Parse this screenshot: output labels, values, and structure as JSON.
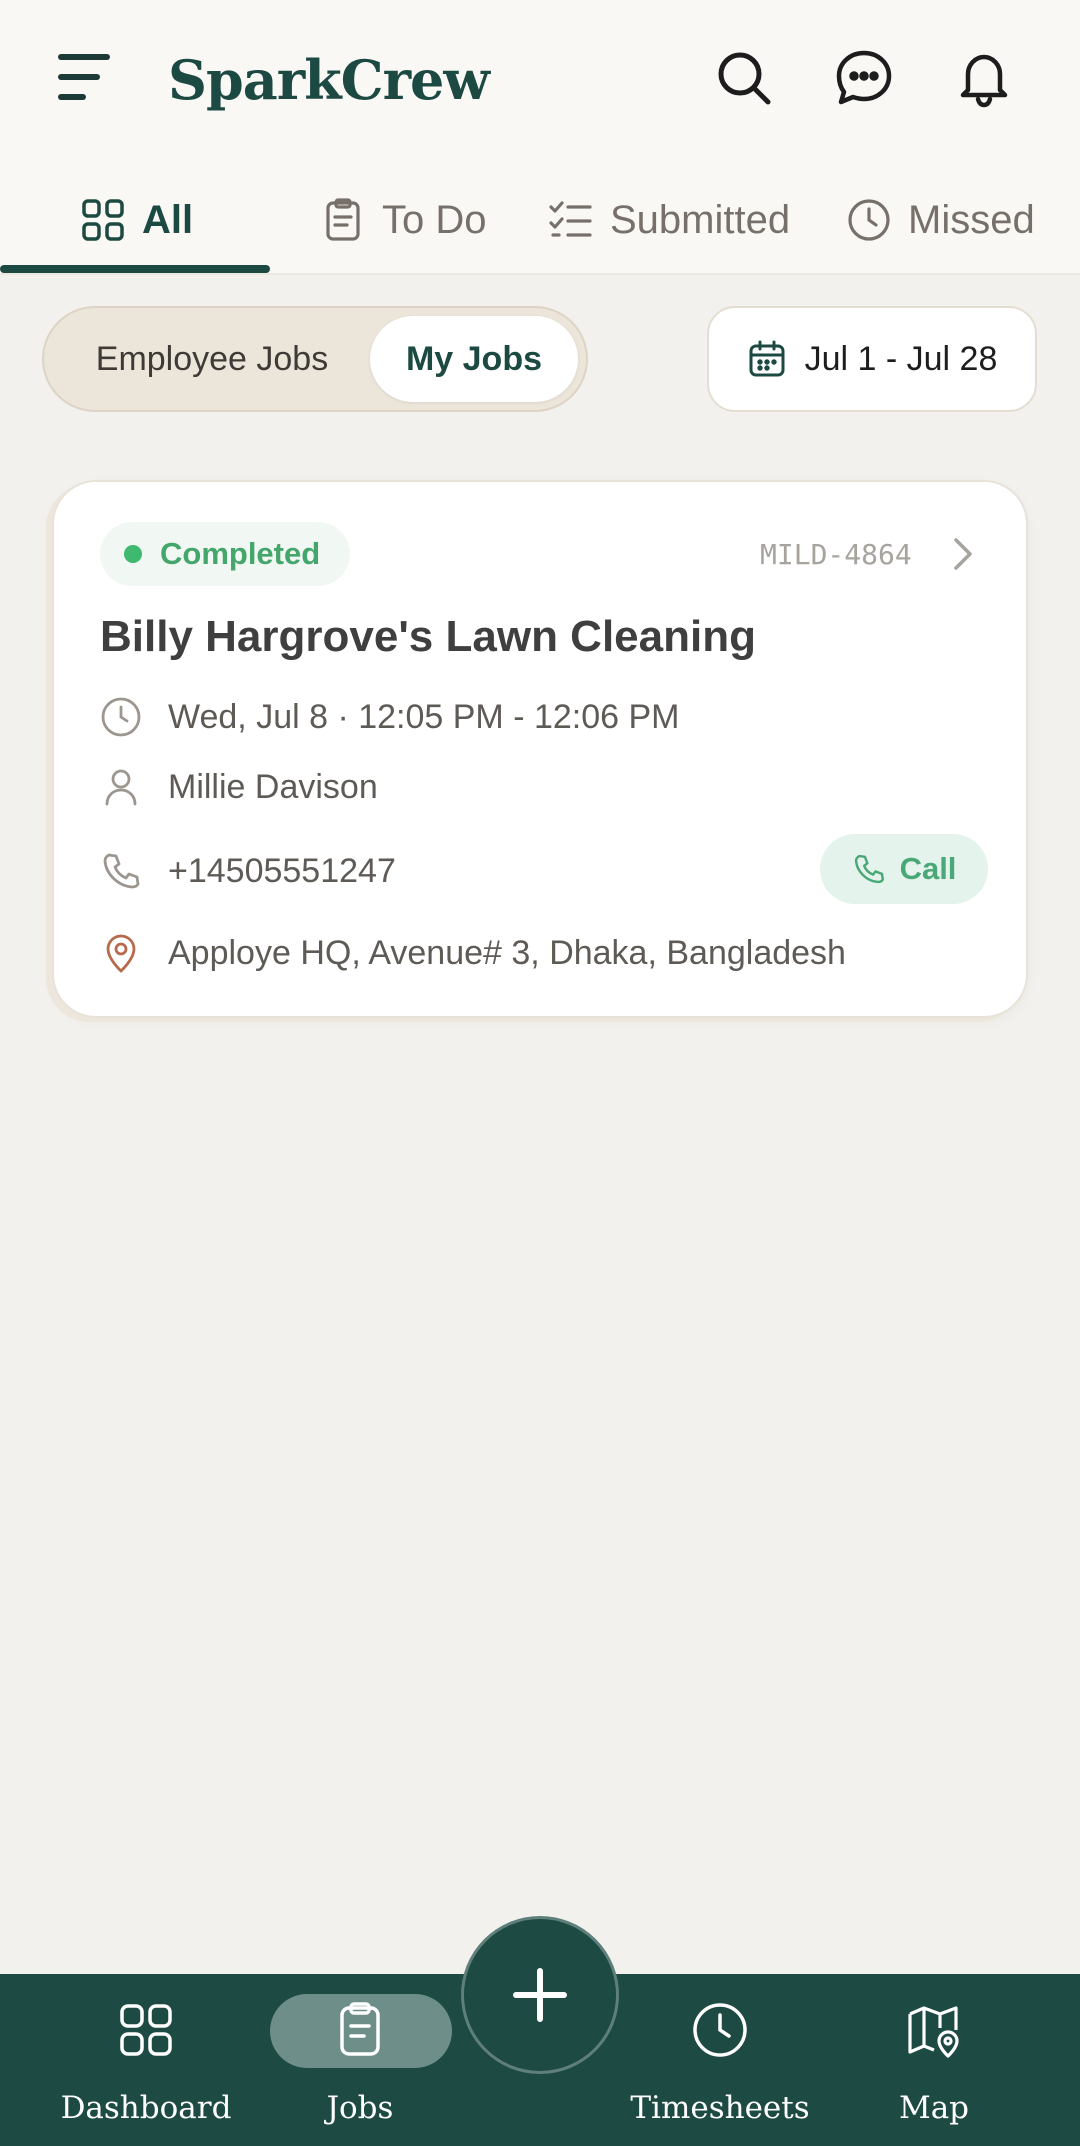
{
  "app": {
    "title": "SparkCrew"
  },
  "header": {
    "icons": [
      "menu-icon",
      "search-icon",
      "chat-icon",
      "bell-icon"
    ]
  },
  "tabs": [
    {
      "label": "All",
      "icon": "grid-icon",
      "active": true
    },
    {
      "label": "To Do",
      "icon": "clipboard-icon",
      "active": false
    },
    {
      "label": "Submitted",
      "icon": "checklist-icon",
      "active": false
    },
    {
      "label": "Missed",
      "icon": "clock-icon",
      "active": false
    }
  ],
  "filters": {
    "segments": [
      {
        "label": "Employee Jobs",
        "active": false
      },
      {
        "label": "My Jobs",
        "active": true
      }
    ],
    "date_range": "Jul 1 - Jul 28"
  },
  "job": {
    "status": "Completed",
    "id": "MILD-4864",
    "title": "Billy Hargrove's Lawn Cleaning",
    "time": "Wed, Jul 8 · 12:05 PM - 12:06 PM",
    "assignee": "Millie Davison",
    "phone": "+14505551247",
    "call_label": "Call",
    "address": "Apploye HQ, Avenue# 3, Dhaka, Bangladesh"
  },
  "bottom_nav": [
    {
      "label": "Dashboard",
      "icon": "grid-icon",
      "active": false
    },
    {
      "label": "Jobs",
      "icon": "clipboard-icon",
      "active": true
    },
    {
      "label": "Timesheets",
      "icon": "clock-icon",
      "active": false
    },
    {
      "label": "Map",
      "icon": "map-pin-icon",
      "active": false
    }
  ],
  "fab": {
    "icon": "plus-icon"
  },
  "colors": {
    "brand": "#1c4a42",
    "background": "#f3f1ed",
    "status_green": "#44a66b",
    "nav_bg": "#1d4a43"
  }
}
